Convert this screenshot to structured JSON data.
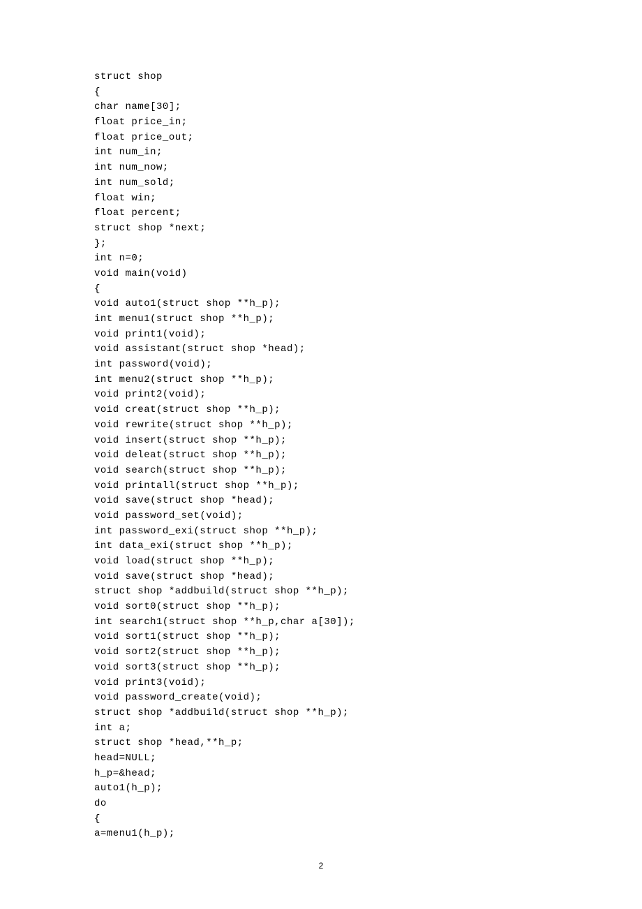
{
  "code_lines": [
    "struct shop",
    "{",
    "char name[30];",
    "float price_in;",
    "float price_out;",
    "int num_in;",
    "int num_now;",
    "int num_sold;",
    "float win;",
    "float percent;",
    "struct shop *next;",
    "};",
    "int n=0;",
    "void main(void)",
    "{",
    "void auto1(struct shop **h_p);",
    "int menu1(struct shop **h_p);",
    "void print1(void);",
    "void assistant(struct shop *head);",
    "int password(void);",
    "int menu2(struct shop **h_p);",
    "void print2(void);",
    "void creat(struct shop **h_p);",
    "void rewrite(struct shop **h_p);",
    "void insert(struct shop **h_p);",
    "void deleat(struct shop **h_p);",
    "void search(struct shop **h_p);",
    "void printall(struct shop **h_p);",
    "void save(struct shop *head);",
    "void password_set(void);",
    "int password_exi(struct shop **h_p);",
    "int data_exi(struct shop **h_p);",
    "void load(struct shop **h_p);",
    "void save(struct shop *head);",
    "struct shop *addbuild(struct shop **h_p);",
    "void sort0(struct shop **h_p);",
    "int search1(struct shop **h_p,char a[30]);",
    "void sort1(struct shop **h_p);",
    "void sort2(struct shop **h_p);",
    "void sort3(struct shop **h_p);",
    "void print3(void);",
    "void password_create(void);",
    "struct shop *addbuild(struct shop **h_p);",
    "int a;",
    "struct shop *head,**h_p;",
    "head=NULL;",
    "h_p=&head;",
    "auto1(h_p);",
    "do",
    "{",
    "a=menu1(h_p);"
  ],
  "page_number": "2"
}
